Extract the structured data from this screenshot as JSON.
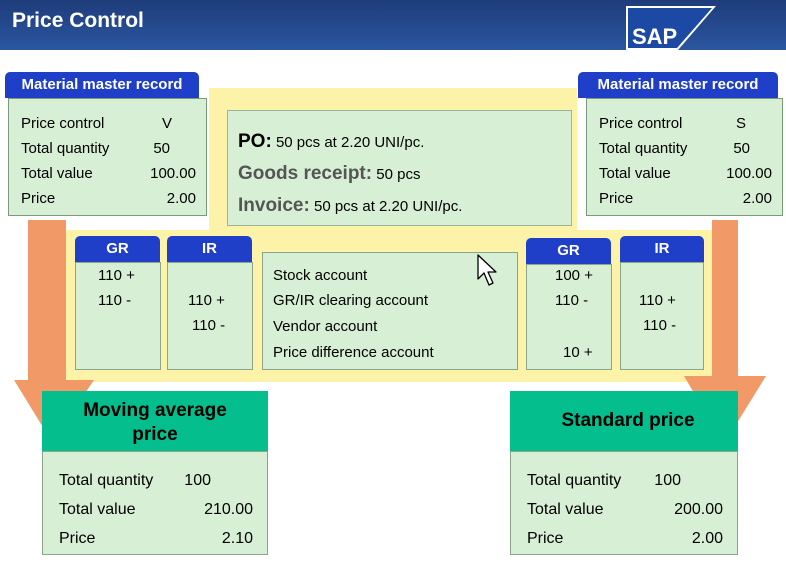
{
  "title": "Price Control",
  "logo": "SAP",
  "left_master": {
    "header": "Material master record",
    "rows": [
      {
        "label": "Price control",
        "value": "V"
      },
      {
        "label": "Total quantity",
        "value": "50"
      },
      {
        "label": "Total value",
        "value": "100.00"
      },
      {
        "label": "Price",
        "value": "2.00"
      }
    ]
  },
  "right_master": {
    "header": "Material master record",
    "rows": [
      {
        "label": "Price control",
        "value": "S"
      },
      {
        "label": "Total quantity",
        "value": "50"
      },
      {
        "label": "Total value",
        "value": "100.00"
      },
      {
        "label": "Price",
        "value": "2.00"
      }
    ]
  },
  "transactions": {
    "po_label": "PO:",
    "po_text": "50 pcs at 2.20 UNI/pc.",
    "gr_label": "Goods receipt:",
    "gr_text": "50 pcs",
    "inv_label": "Invoice:",
    "inv_text": "50 pcs at 2.20 UNI/pc."
  },
  "accounts": [
    "Stock account",
    "GR/IR clearing account",
    "Vendor account",
    "Price difference account"
  ],
  "left_ledger": {
    "gr_header": "GR",
    "ir_header": "IR",
    "gr_values": [
      "110 +",
      "110 -",
      "",
      ""
    ],
    "ir_values": [
      "",
      "110 +",
      "110 -",
      ""
    ]
  },
  "right_ledger": {
    "gr_header": "GR",
    "ir_header": "IR",
    "gr_values": [
      "100 +",
      "110 -",
      "",
      "10 +"
    ],
    "ir_values": [
      "",
      "110 +",
      "110 -",
      ""
    ]
  },
  "moving_avg": {
    "header": "Moving average price",
    "rows": [
      {
        "label": "Total quantity",
        "value": "100"
      },
      {
        "label": "Total value",
        "value": "210.00"
      },
      {
        "label": "Price",
        "value": "2.10"
      }
    ]
  },
  "standard": {
    "header": "Standard price",
    "rows": [
      {
        "label": "Total quantity",
        "value": "100"
      },
      {
        "label": "Total value",
        "value": "200.00"
      },
      {
        "label": "Price",
        "value": "2.00"
      }
    ]
  },
  "colors": {
    "title_bar": "#1e3c7a",
    "header_blue": "#1f3fc8",
    "green_box": "#d7f0d5",
    "yellow_band": "#fcf2a8",
    "arrow": "#f19a68",
    "teal": "#04be8e"
  },
  "icons": [
    "mouse-pointer-icon"
  ]
}
